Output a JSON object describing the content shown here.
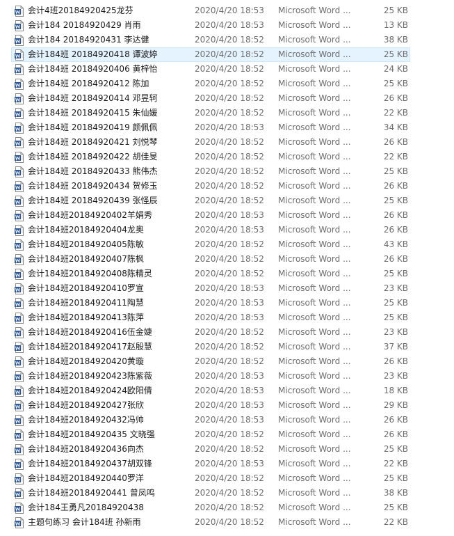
{
  "file_list": {
    "rows": [
      {
        "name": "会计4班20184920425龙芬",
        "date": "2020/4/20 18:53",
        "type": "Microsoft Word ...",
        "size": "25 KB",
        "icon": "word-document-icon"
      },
      {
        "name": "会计184 20184920429 肖雨",
        "date": "2020/4/20 18:53",
        "type": "Microsoft Word ...",
        "size": "13 KB",
        "icon": "word-document-icon"
      },
      {
        "name": "会计184 20184920431 李达健",
        "date": "2020/4/20 18:52",
        "type": "Microsoft Word ...",
        "size": "38 KB",
        "icon": "word-document-icon"
      },
      {
        "name": "会计184班 20184920418 谭波婷",
        "date": "2020/4/20 18:52",
        "type": "Microsoft Word ...",
        "size": "25 KB",
        "icon": "word-document-icon",
        "selected": true
      },
      {
        "name": "会计184班 20184920406 黄梓怡",
        "date": "2020/4/20 18:52",
        "type": "Microsoft Word ...",
        "size": "24 KB",
        "icon": "word-document-icon"
      },
      {
        "name": "会计184班 20184920412 陈加",
        "date": "2020/4/20 18:52",
        "type": "Microsoft Word ...",
        "size": "25 KB",
        "icon": "word-document-icon"
      },
      {
        "name": "会计184班 20184920414 邓昱轲",
        "date": "2020/4/20 18:52",
        "type": "Microsoft Word ...",
        "size": "26 KB",
        "icon": "word-document-icon"
      },
      {
        "name": "会计184班 20184920415 朱仙媛",
        "date": "2020/4/20 18:52",
        "type": "Microsoft Word ...",
        "size": "22 KB",
        "icon": "word-document-icon"
      },
      {
        "name": "会计184班 20184920419 颜佩佩",
        "date": "2020/4/20 18:53",
        "type": "Microsoft Word ...",
        "size": "34 KB",
        "icon": "word-document-icon"
      },
      {
        "name": "会计184班 20184920421 刘悦琴",
        "date": "2020/4/20 18:52",
        "type": "Microsoft Word ...",
        "size": "26 KB",
        "icon": "word-document-icon"
      },
      {
        "name": "会计184班 20184920422 胡佳旻",
        "date": "2020/4/20 18:52",
        "type": "Microsoft Word ...",
        "size": "22 KB",
        "icon": "word-document-icon"
      },
      {
        "name": "会计184班 20184920433 熊伟杰",
        "date": "2020/4/20 18:52",
        "type": "Microsoft Word ...",
        "size": "25 KB",
        "icon": "word-document-icon"
      },
      {
        "name": "会计184班 20184920434 贺修玉",
        "date": "2020/4/20 18:52",
        "type": "Microsoft Word ...",
        "size": "26 KB",
        "icon": "word-document-icon"
      },
      {
        "name": "会计184班 20184920439 张怪辰",
        "date": "2020/4/20 18:52",
        "type": "Microsoft Word ...",
        "size": "25 KB",
        "icon": "word-document-icon"
      },
      {
        "name": "会计184班20184920402羊娟秀",
        "date": "2020/4/20 18:53",
        "type": "Microsoft Word ...",
        "size": "26 KB",
        "icon": "word-document-icon"
      },
      {
        "name": "会计184班20184920404龙奥",
        "date": "2020/4/20 18:53",
        "type": "Microsoft Word ...",
        "size": "26 KB",
        "icon": "word-document-icon"
      },
      {
        "name": "会计184班20184920405陈敏",
        "date": "2020/4/20 18:52",
        "type": "Microsoft Word ...",
        "size": "43 KB",
        "icon": "word-document-icon"
      },
      {
        "name": "会计184班20184920407陈枫",
        "date": "2020/4/20 18:52",
        "type": "Microsoft Word ...",
        "size": "26 KB",
        "icon": "word-document-icon"
      },
      {
        "name": "会计184班20184920408陈精灵",
        "date": "2020/4/20 18:52",
        "type": "Microsoft Word ...",
        "size": "25 KB",
        "icon": "word-document-icon"
      },
      {
        "name": "会计184班20184920410罗宣",
        "date": "2020/4/20 18:53",
        "type": "Microsoft Word ...",
        "size": "23 KB",
        "icon": "word-document-icon"
      },
      {
        "name": "会计184班20184920411陶慧",
        "date": "2020/4/20 18:53",
        "type": "Microsoft Word ...",
        "size": "25 KB",
        "icon": "word-document-icon"
      },
      {
        "name": "会计184班20184920413陈萍",
        "date": "2020/4/20 18:53",
        "type": "Microsoft Word ...",
        "size": "25 KB",
        "icon": "word-document-icon"
      },
      {
        "name": "会计184班20184920416伍金婕",
        "date": "2020/4/20 18:52",
        "type": "Microsoft Word ...",
        "size": "23 KB",
        "icon": "word-document-icon"
      },
      {
        "name": "会计184班20184920417赵殷慧",
        "date": "2020/4/20 18:52",
        "type": "Microsoft Word ...",
        "size": "37 KB",
        "icon": "word-document-icon"
      },
      {
        "name": "会计184班20184920420黄璇",
        "date": "2020/4/20 18:52",
        "type": "Microsoft Word ...",
        "size": "26 KB",
        "icon": "word-document-icon"
      },
      {
        "name": "会计184班20184920423陈紫薇",
        "date": "2020/4/20 18:53",
        "type": "Microsoft Word ...",
        "size": "23 KB",
        "icon": "word-document-icon"
      },
      {
        "name": "会计184班20184920424欧阳倩",
        "date": "2020/4/20 18:53",
        "type": "Microsoft Word ...",
        "size": "18 KB",
        "icon": "word-document-icon"
      },
      {
        "name": "会计184班20184920427张欣",
        "date": "2020/4/20 18:53",
        "type": "Microsoft Word ...",
        "size": "29 KB",
        "icon": "word-document-icon"
      },
      {
        "name": "会计184班20184920432冯帅",
        "date": "2020/4/20 18:53",
        "type": "Microsoft Word ...",
        "size": "26 KB",
        "icon": "word-document-icon"
      },
      {
        "name": "会计184班20184920435 文晓强",
        "date": "2020/4/20 18:52",
        "type": "Microsoft Word ...",
        "size": "26 KB",
        "icon": "word-document-icon"
      },
      {
        "name": "会计184班20184920436向杰",
        "date": "2020/4/20 18:52",
        "type": "Microsoft Word ...",
        "size": "25 KB",
        "icon": "word-document-icon"
      },
      {
        "name": "会计184班20184920437胡双锋",
        "date": "2020/4/20 18:53",
        "type": "Microsoft Word ...",
        "size": "22 KB",
        "icon": "word-document-icon"
      },
      {
        "name": "会计184班20184920440罗洋",
        "date": "2020/4/20 18:52",
        "type": "Microsoft Word ...",
        "size": "25 KB",
        "icon": "word-document-icon"
      },
      {
        "name": "会计184班20184920441 曾凤鸣",
        "date": "2020/4/20 18:52",
        "type": "Microsoft Word ...",
        "size": "38 KB",
        "icon": "word-document-icon"
      },
      {
        "name": "会计184王勇凡20184920438",
        "date": "2020/4/20 18:52",
        "type": "Microsoft Word ...",
        "size": "25 KB",
        "icon": "word-document-icon"
      },
      {
        "name": "主题句练习 会计184班 孙新雨",
        "date": "2020/4/20 18:52",
        "type": "Microsoft Word ...",
        "size": "22 KB",
        "icon": "word-document-icon"
      }
    ]
  },
  "colors": {
    "selected_background": "#e5f3ff",
    "selected_border": "#cce8ff",
    "word_blue": "#2b579a",
    "secondary_text": "#6d6d6d"
  }
}
